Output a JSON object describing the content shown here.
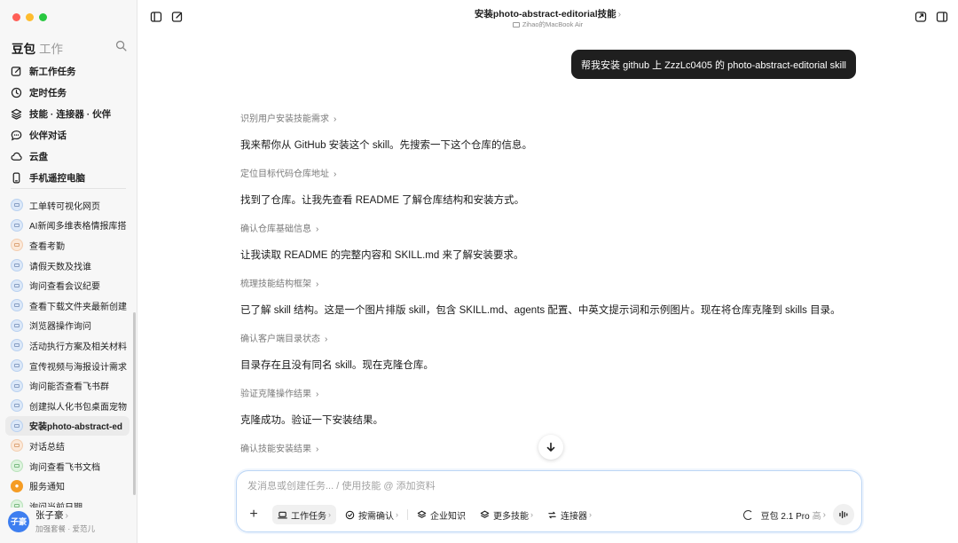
{
  "sidebar": {
    "brand": "豆包",
    "brand_sub": "工作",
    "nav": [
      {
        "label": "新工作任务",
        "icon": "edit-icon"
      },
      {
        "label": "定时任务",
        "icon": "clock-icon"
      },
      {
        "label": "技能 · 连接器 · 伙伴",
        "icon": "layers-icon"
      },
      {
        "label": "伙伴对话",
        "icon": "chat-icon"
      },
      {
        "label": "云盘",
        "icon": "cloud-icon"
      },
      {
        "label": "手机遥控电脑",
        "icon": "phone-icon"
      }
    ],
    "chats": [
      {
        "label": "工单转可视化网页",
        "color": "blue"
      },
      {
        "label": "AI新闻多维表格情报库搭",
        "color": "blue"
      },
      {
        "label": "查看考勤",
        "color": "peach"
      },
      {
        "label": "请假天数及找谁",
        "color": "blue"
      },
      {
        "label": "询问查看会议纪要",
        "color": "blue"
      },
      {
        "label": "查看下载文件夹最新创建",
        "color": "blue"
      },
      {
        "label": "浏览器操作询问",
        "color": "blue"
      },
      {
        "label": "活动执行方案及相关材料",
        "color": "blue"
      },
      {
        "label": "宣传视频与海报设计需求",
        "color": "blue"
      },
      {
        "label": "询问能否查看飞书群",
        "color": "blue"
      },
      {
        "label": "创建拟人化书包桌面宠物",
        "color": "blue"
      },
      {
        "label": "安装photo-abstract-ed",
        "color": "blue",
        "active": true
      },
      {
        "label": "对话总结",
        "color": "peach"
      },
      {
        "label": "询问查看飞书文档",
        "color": "green"
      },
      {
        "label": "服务通知",
        "color": "orange"
      },
      {
        "label": "询问当前日期",
        "color": "green"
      }
    ],
    "user": {
      "avatar": "子豪",
      "name": "张子豪",
      "plan": "加强套餐 · 爱范儿"
    }
  },
  "header": {
    "title": "安装photo-abstract-editorial技能",
    "subtitle": "Zihao的MacBook Air"
  },
  "conversation": {
    "user_message": "帮我安装 github 上 ZzzLc0405 的 photo-abstract-editorial skill",
    "steps": [
      {
        "label": "识别用户安装技能需求",
        "text": "我来帮你从 GitHub 安装这个 skill。先搜索一下这个仓库的信息。"
      },
      {
        "label": "定位目标代码仓库地址",
        "text": "找到了仓库。让我先查看 README 了解仓库结构和安装方式。"
      },
      {
        "label": "确认仓库基础信息",
        "text": "让我读取 README 的完整内容和 SKILL.md 来了解安装要求。"
      },
      {
        "label": "梳理技能结构框架",
        "text": "已了解 skill 结构。这是一个图片排版 skill，包含 SKILL.md、agents 配置、中英文提示词和示例图片。现在将仓库克隆到 skills 目录。"
      },
      {
        "label": "确认客户端目录状态",
        "text": "目录存在且没有同名 skill。现在克隆仓库。"
      },
      {
        "label": "验证克隆操作结果",
        "text": "克隆成功。验证一下安装结果。"
      },
      {
        "label": "确认技能安装结果",
        "text": ""
      }
    ]
  },
  "composer": {
    "placeholder": "发消息或创建任务... / 使用技能 @ 添加资料",
    "tools": [
      {
        "label": "工作任务",
        "icon": "laptop-icon",
        "pill": true,
        "chevron": true
      },
      {
        "label": "按需确认",
        "icon": "check-circle-icon",
        "pill": false,
        "chevron": true
      },
      {
        "label": "企业知识",
        "icon": "layers-icon",
        "pill": false,
        "chevron": false
      },
      {
        "label": "更多技能",
        "icon": "layers-icon",
        "pill": false,
        "chevron": true
      },
      {
        "label": "连接器",
        "icon": "connector-icon",
        "pill": false,
        "chevron": true
      }
    ],
    "model": "豆包 2.1 Pro",
    "model_tier": "高"
  },
  "colors": {
    "accent_border": "#bcd6f5",
    "bubble": "#1f1f1f",
    "avatar": "#3d7ef0"
  }
}
